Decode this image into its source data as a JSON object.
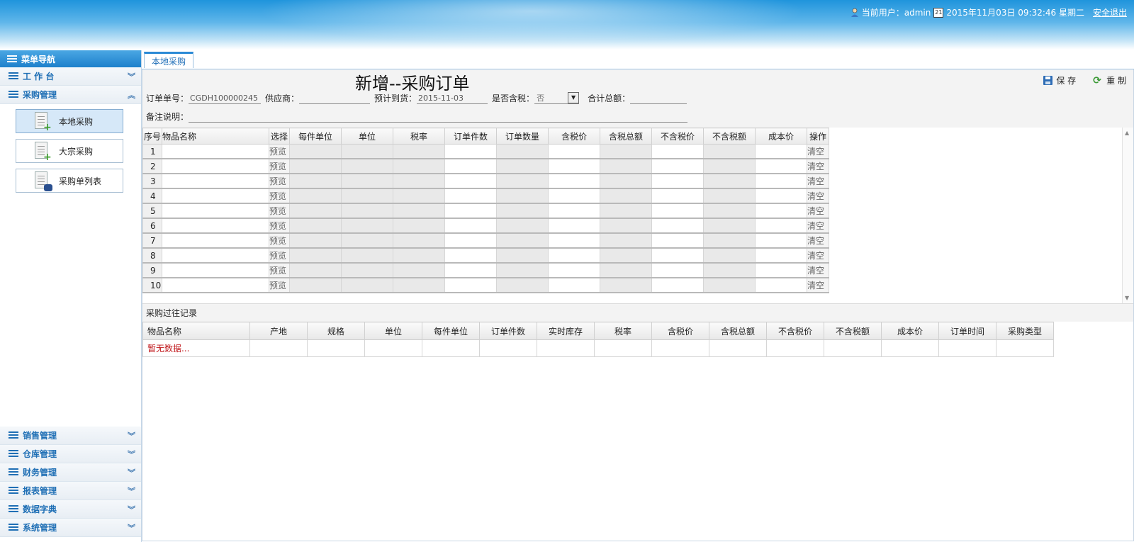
{
  "header": {
    "user_label": "当前用户：admin",
    "datetime": "2015年11月03日 09:32:46 星期二",
    "calendar_day": "21",
    "logout": "安全退出"
  },
  "sidebar": {
    "title": "菜单导航",
    "sections_top": [
      {
        "label": "工 作 台",
        "expanded": false
      },
      {
        "label": "采购管理",
        "expanded": true
      }
    ],
    "sub_items": [
      {
        "label": "本地采购",
        "icon": "add-doc-icon",
        "active": true
      },
      {
        "label": "大宗采购",
        "icon": "add-doc-icon",
        "active": false
      },
      {
        "label": "采购单列表",
        "icon": "search-doc-icon",
        "active": false
      }
    ],
    "sections_bottom": [
      {
        "label": "销售管理"
      },
      {
        "label": "仓库管理"
      },
      {
        "label": "财务管理"
      },
      {
        "label": "报表管理"
      },
      {
        "label": "数据字典"
      },
      {
        "label": "系统管理"
      }
    ]
  },
  "tab": {
    "label": "本地采购"
  },
  "form": {
    "title": "新增--采购订单",
    "save_label": "保 存",
    "reset_label": "重 制",
    "order_no_label": "订单单号：",
    "order_no_value": "CGDH100000245",
    "supplier_label": "供应商：",
    "supplier_value": "",
    "eta_label": "预计到货：",
    "eta_value": "2015-11-03",
    "tax_label": "是否含税：",
    "tax_value": "否",
    "total_label": "合计总额：",
    "total_value": "",
    "remark_label": "备注说明：",
    "remark_value": ""
  },
  "grid": {
    "headers": [
      "序号",
      "物品名称",
      "选择",
      "每件单位",
      "单位",
      "税率",
      "订单件数",
      "订单数量",
      "含税价",
      "含税总额",
      "不含税价",
      "不含税额",
      "成本价",
      "操作"
    ],
    "preview_label": "预览",
    "clear_label": "清空",
    "rows": [
      "1",
      "2",
      "3",
      "4",
      "5",
      "6",
      "7",
      "8",
      "9",
      "10"
    ]
  },
  "history": {
    "title": "采购过往记录",
    "headers": [
      "物品名称",
      "产地",
      "规格",
      "单位",
      "每件单位",
      "订单件数",
      "实时库存",
      "税率",
      "含税价",
      "含税总额",
      "不含税价",
      "不含税额",
      "成本价",
      "订单时间",
      "采购类型"
    ],
    "empty_text": "暂无数据..."
  }
}
